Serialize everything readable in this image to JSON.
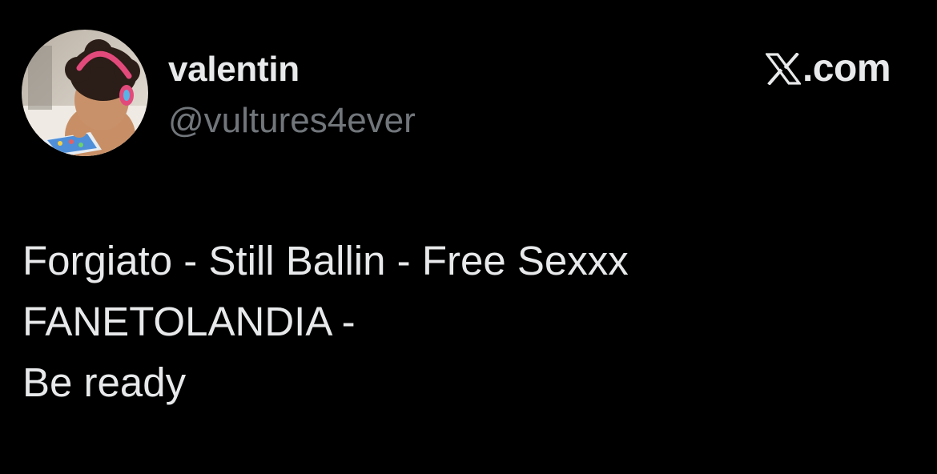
{
  "author": {
    "display_name": "valentin",
    "handle": "@vultures4ever",
    "avatar_icon": "profile-photo-child-with-tablet"
  },
  "brand": {
    "logo_icon": "x-logo-icon",
    "label": ".com"
  },
  "tweet": {
    "lines": [
      "Forgiato - Still Ballin - Free Sexxx",
      "FANETOLANDIA -",
      "Be ready"
    ]
  },
  "colors": {
    "background": "#000000",
    "primary_text": "#e7e9ea",
    "secondary_text": "#71767b"
  }
}
